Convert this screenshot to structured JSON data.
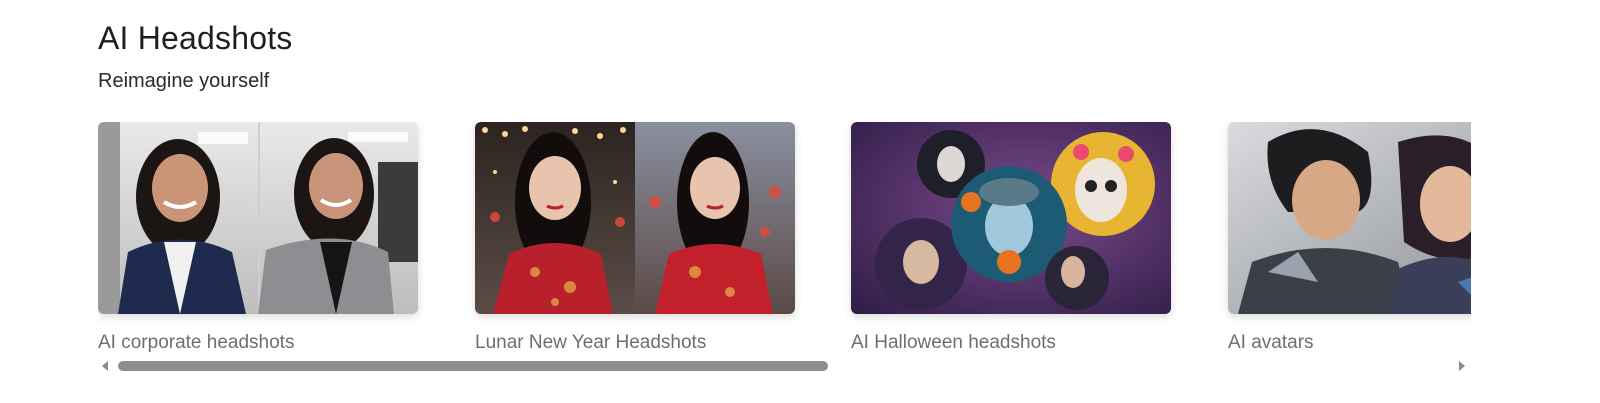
{
  "page": {
    "title": "AI Headshots",
    "subtitle": "Reimagine yourself"
  },
  "cards": [
    {
      "label": "AI corporate headshots",
      "image_icon": "corporate-headshot-photo"
    },
    {
      "label": "Lunar New Year Headshots",
      "image_icon": "lunar-new-year-photo"
    },
    {
      "label": "AI Halloween headshots",
      "image_icon": "halloween-photo"
    },
    {
      "label": "AI avatars",
      "image_icon": "avatar-artwork"
    }
  ],
  "scrollbar": {
    "left_arrow_icon": "triangle-left-icon",
    "right_arrow_icon": "triangle-right-icon",
    "visible_fraction": 0.52,
    "position": 0.0
  },
  "colors": {
    "title": "#1f1f1f",
    "label": "#6e6e6e",
    "scroll_thumb": "#8d8d8d"
  }
}
